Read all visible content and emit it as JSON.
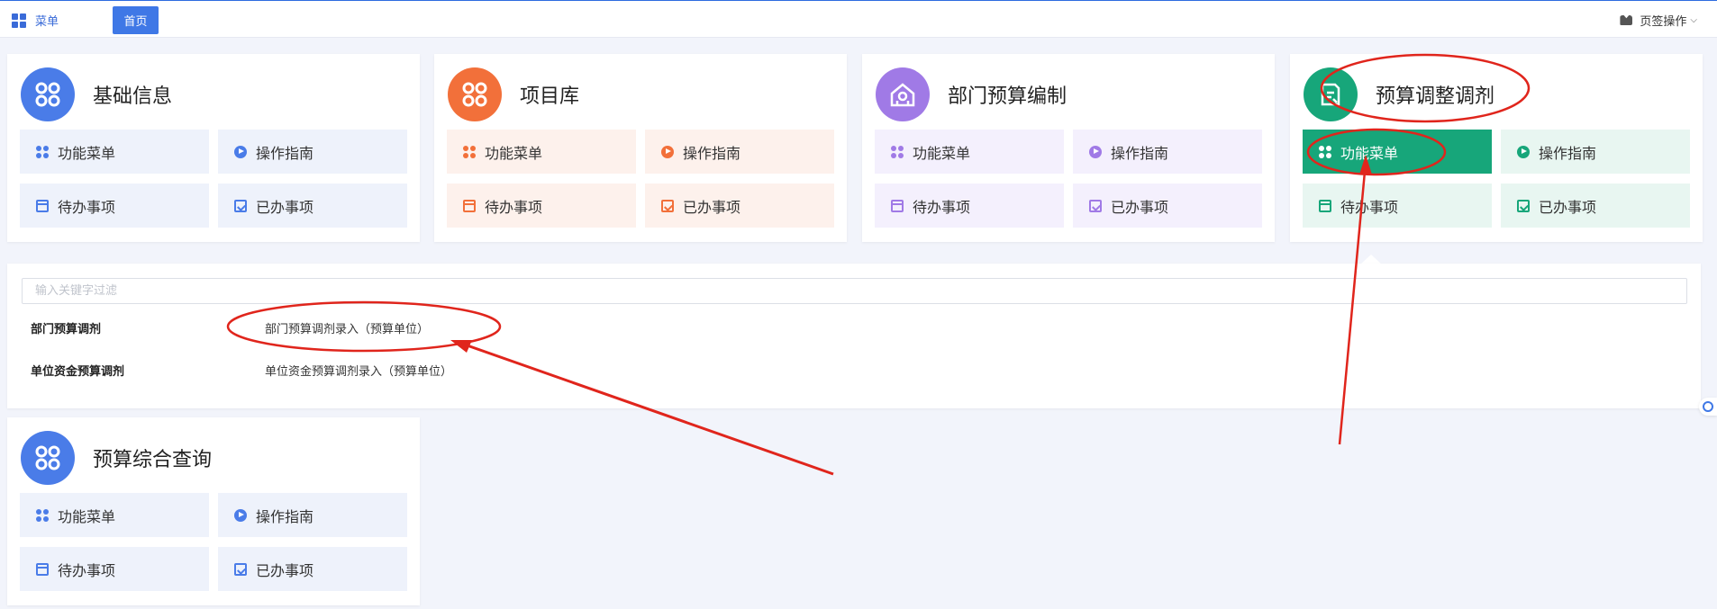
{
  "topbar": {
    "menu_label": "菜单",
    "home_tab": "首页",
    "page_ops": "页签操作"
  },
  "cards": [
    {
      "title": "基础信息",
      "icon": "apps-icon",
      "color": "#4a7ce8",
      "tint": "#eef2fb",
      "tiles": [
        "功能菜单",
        "操作指南",
        "待办事项",
        "已办事项"
      ]
    },
    {
      "title": "项目库",
      "icon": "apps-icon",
      "color": "#f2703a",
      "tint": "#fdf1ec",
      "tiles": [
        "功能菜单",
        "操作指南",
        "待办事项",
        "已办事项"
      ]
    },
    {
      "title": "部门预算编制",
      "icon": "budget-house-icon",
      "color": "#a07ae6",
      "tint": "#f4f0fd",
      "tiles": [
        "功能菜单",
        "操作指南",
        "待办事项",
        "已办事项"
      ]
    },
    {
      "title": "预算调整调剂",
      "icon": "budget-adjust-icon",
      "color": "#17a67a",
      "tint": "#e8f6f1",
      "tiles": [
        "功能菜单",
        "操作指南",
        "待办事项",
        "已办事项"
      ],
      "active_tile": 0
    },
    {
      "title": "预算综合查询",
      "icon": "apps-icon",
      "color": "#4a7ce8",
      "tint": "#eef2fb",
      "tiles": [
        "功能菜单",
        "操作指南",
        "待办事项",
        "已办事项"
      ]
    }
  ],
  "panel": {
    "filter_placeholder": "输入关键字过滤",
    "rows": [
      {
        "label": "部门预算调剂",
        "link": "部门预算调剂录入（预算单位）"
      },
      {
        "label": "单位资金预算调剂",
        "link": "单位资金预算调剂录入（预算单位）"
      }
    ]
  },
  "annotation_color": "#e0251c"
}
